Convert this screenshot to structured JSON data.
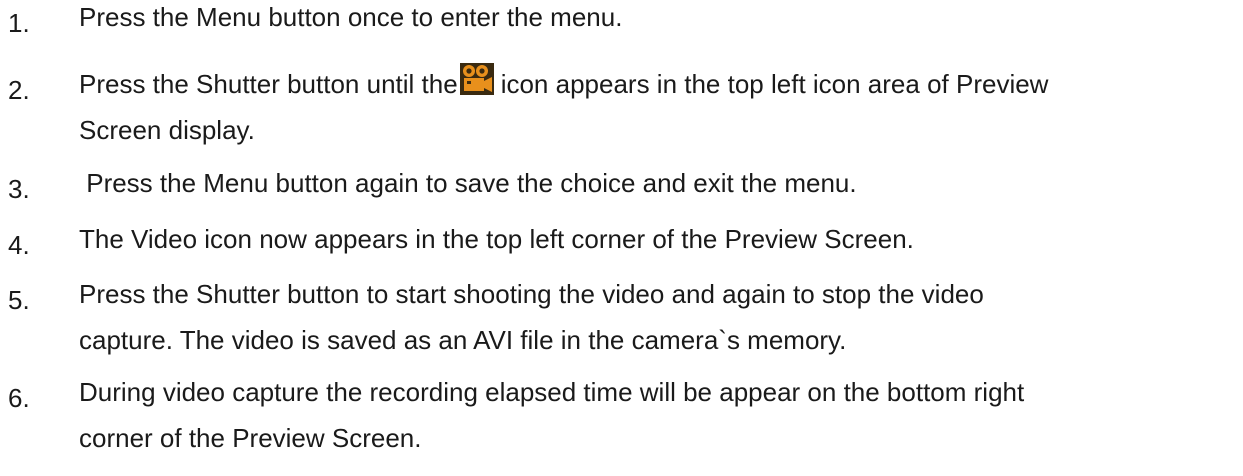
{
  "steps": [
    {
      "number": "1.",
      "lines": [
        "Press the Menu button once to enter the menu."
      ]
    },
    {
      "number": "2.",
      "before_icon": "Press the Shutter button until the",
      "icon": "video-camera-icon",
      "after_icon": "icon appears in the top left icon area of Preview",
      "line2": "Screen display."
    },
    {
      "number": "3.",
      "lines": [
        " Press the Menu button again to save the choice and exit the menu."
      ]
    },
    {
      "number": "4.",
      "lines": [
        "The Video icon now appears in the top left corner of the Preview Screen."
      ]
    },
    {
      "number": "5.",
      "lines": [
        "Press the Shutter button to start shooting the video and again to stop the video",
        "capture. The video is saved as an AVI file in the camera`s memory."
      ]
    },
    {
      "number": "6.",
      "lines": [
        "During video capture the recording elapsed time will be appear on the bottom right",
        "corner of the Preview Screen."
      ]
    }
  ],
  "colors": {
    "text": "#1a1a1a",
    "icon_orange": "#e8901c",
    "icon_dark": "#3a2a10"
  }
}
